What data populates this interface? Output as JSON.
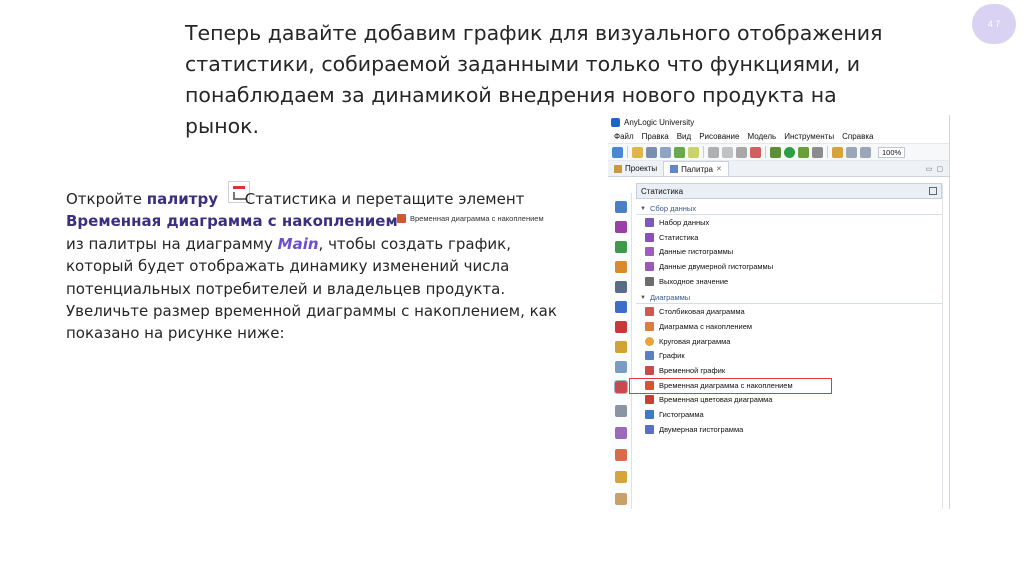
{
  "page_number": "4 7",
  "slide_title": "Теперь давайте добавим график для визуального отображения статистики, собираемой заданными только что функциями, и понаблюдаем за динамикой внедрения нового продукта на рынок.",
  "body": {
    "p1_a": "Откройте ",
    "p1_palette": "палитру",
    "p1_b": " Статистика и перетащите элемент",
    "p1_element": "Временная диаграмма с накоплением",
    "inline_element_label": "Временная диаграмма с накоплением",
    "p1_c": "из палитры на диаграмму ",
    "p1_main": "Main",
    "p1_d": ", чтобы создать график, который будет отображать динамику изменений числа потенциальных потребителей и владельцев продукта. Увеличьте размер временной диаграммы с накоплением, как показано на рисунке ниже:"
  },
  "app": {
    "title": "AnyLogic University",
    "menu": [
      "Файл",
      "Правка",
      "Вид",
      "Рисование",
      "Модель",
      "Инструменты",
      "Справка"
    ],
    "zoom": "100%",
    "tabs": [
      {
        "label": "Проекты",
        "active": false
      },
      {
        "label": "Палитра",
        "active": true
      }
    ],
    "panel_title": "Статистика",
    "sections": [
      {
        "title": "Сбор данных",
        "items": [
          {
            "label": "Набор данных",
            "icon": "dataset-icon",
            "color": "#7b5bb7"
          },
          {
            "label": "Статистика",
            "icon": "statistics-icon",
            "color": "#8a4fb8"
          },
          {
            "label": "Данные гистограммы",
            "icon": "histogram-data-icon",
            "color": "#a05cc0"
          },
          {
            "label": "Данные двумерной гистограммы",
            "icon": "histogram2d-data-icon",
            "color": "#9a58b8"
          },
          {
            "label": "Выходное значение",
            "icon": "output-value-icon",
            "color": "#6c6c6c"
          }
        ]
      },
      {
        "title": "Диаграммы",
        "items": [
          {
            "label": "Столбиковая диаграмма",
            "icon": "bar-chart-icon",
            "color": "#d9534f"
          },
          {
            "label": "Диаграмма с накоплением",
            "icon": "stack-chart-icon",
            "color": "#e07b39"
          },
          {
            "label": "Круговая диаграмма",
            "icon": "pie-chart-icon",
            "color": "#e8a33d"
          },
          {
            "label": "График",
            "icon": "plot-icon",
            "color": "#5a7fc2"
          },
          {
            "label": "Временной график",
            "icon": "time-plot-icon",
            "color": "#c94a4a"
          },
          {
            "label": "Временная диаграмма с накоплением",
            "icon": "time-stack-chart-icon",
            "color": "#d2572f"
          },
          {
            "label": "Временная цветовая диаграмма",
            "icon": "time-color-chart-icon",
            "color": "#c9412c"
          },
          {
            "label": "Гистограмма",
            "icon": "histogram-icon",
            "color": "#3e7bc7"
          },
          {
            "label": "Двумерная гистограмма",
            "icon": "histogram2d-icon",
            "color": "#5a6fc4"
          }
        ]
      }
    ]
  }
}
